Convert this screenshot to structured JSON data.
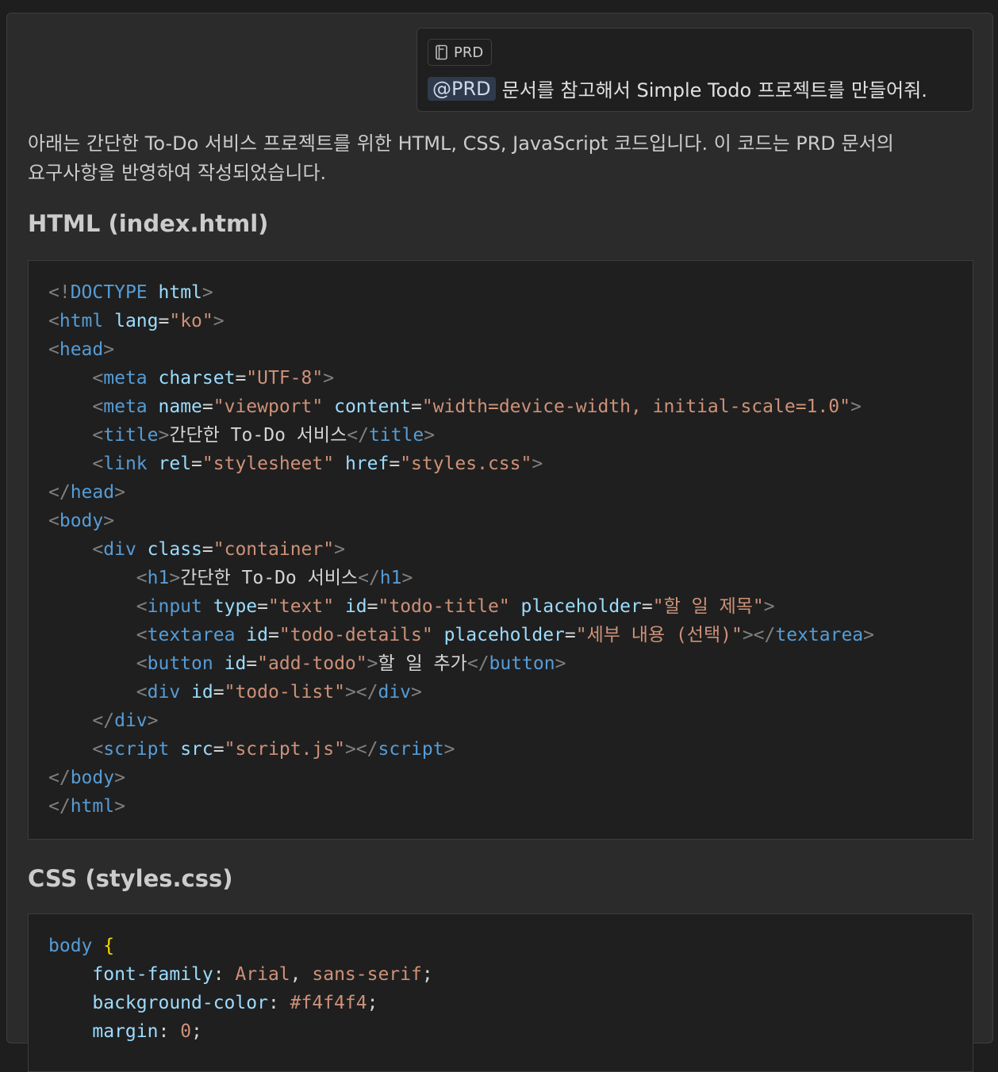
{
  "user_message": {
    "context_chip": {
      "icon": "document-icon",
      "label": "PRD"
    },
    "mention": "@PRD",
    "text": "문서를 참고해서 Simple Todo 프로젝트를 만들어줘."
  },
  "assistant": {
    "intro_line1": "아래는 간단한 To-Do 서비스 프로젝트를 위한 HTML, CSS, JavaScript 코드입니다. 이 코드는 PRD 문서의",
    "intro_line2": "요구사항을 반영하여 작성되었습니다.",
    "html_heading": "HTML (index.html)",
    "css_heading": "CSS (styles.css)",
    "html_code": [
      [
        [
          "br",
          "<!"
        ],
        [
          "tag",
          "DOCTYPE"
        ],
        [
          "txt",
          " "
        ],
        [
          "attr",
          "html"
        ],
        [
          "br",
          ">"
        ]
      ],
      [
        [
          "br",
          "<"
        ],
        [
          "tag",
          "html"
        ],
        [
          "txt",
          " "
        ],
        [
          "attr",
          "lang"
        ],
        [
          "txt",
          "="
        ],
        [
          "str",
          "\"ko\""
        ],
        [
          "br",
          ">"
        ]
      ],
      [
        [
          "br",
          "<"
        ],
        [
          "tag",
          "head"
        ],
        [
          "br",
          ">"
        ]
      ],
      [
        [
          "txt",
          "    "
        ],
        [
          "br",
          "<"
        ],
        [
          "tag",
          "meta"
        ],
        [
          "txt",
          " "
        ],
        [
          "attr",
          "charset"
        ],
        [
          "txt",
          "="
        ],
        [
          "str",
          "\"UTF-8\""
        ],
        [
          "br",
          ">"
        ]
      ],
      [
        [
          "txt",
          "    "
        ],
        [
          "br",
          "<"
        ],
        [
          "tag",
          "meta"
        ],
        [
          "txt",
          " "
        ],
        [
          "attr",
          "name"
        ],
        [
          "txt",
          "="
        ],
        [
          "str",
          "\"viewport\""
        ],
        [
          "txt",
          " "
        ],
        [
          "attr",
          "content"
        ],
        [
          "txt",
          "="
        ],
        [
          "str",
          "\"width=device-width, initial-scale=1.0\""
        ],
        [
          "br",
          ">"
        ]
      ],
      [
        [
          "txt",
          "    "
        ],
        [
          "br",
          "<"
        ],
        [
          "tag",
          "title"
        ],
        [
          "br",
          ">"
        ],
        [
          "txt",
          "간단한 To-Do 서비스"
        ],
        [
          "br",
          "</"
        ],
        [
          "tag",
          "title"
        ],
        [
          "br",
          ">"
        ]
      ],
      [
        [
          "txt",
          "    "
        ],
        [
          "br",
          "<"
        ],
        [
          "tag",
          "link"
        ],
        [
          "txt",
          " "
        ],
        [
          "attr",
          "rel"
        ],
        [
          "txt",
          "="
        ],
        [
          "str",
          "\"stylesheet\""
        ],
        [
          "txt",
          " "
        ],
        [
          "attr",
          "href"
        ],
        [
          "txt",
          "="
        ],
        [
          "str",
          "\"styles.css\""
        ],
        [
          "br",
          ">"
        ]
      ],
      [
        [
          "br",
          "</"
        ],
        [
          "tag",
          "head"
        ],
        [
          "br",
          ">"
        ]
      ],
      [
        [
          "br",
          "<"
        ],
        [
          "tag",
          "body"
        ],
        [
          "br",
          ">"
        ]
      ],
      [
        [
          "txt",
          "    "
        ],
        [
          "br",
          "<"
        ],
        [
          "tag",
          "div"
        ],
        [
          "txt",
          " "
        ],
        [
          "attr",
          "class"
        ],
        [
          "txt",
          "="
        ],
        [
          "str",
          "\"container\""
        ],
        [
          "br",
          ">"
        ]
      ],
      [
        [
          "txt",
          "        "
        ],
        [
          "br",
          "<"
        ],
        [
          "tag",
          "h1"
        ],
        [
          "br",
          ">"
        ],
        [
          "txt",
          "간단한 To-Do 서비스"
        ],
        [
          "br",
          "</"
        ],
        [
          "tag",
          "h1"
        ],
        [
          "br",
          ">"
        ]
      ],
      [
        [
          "txt",
          "        "
        ],
        [
          "br",
          "<"
        ],
        [
          "tag",
          "input"
        ],
        [
          "txt",
          " "
        ],
        [
          "attr",
          "type"
        ],
        [
          "txt",
          "="
        ],
        [
          "str",
          "\"text\""
        ],
        [
          "txt",
          " "
        ],
        [
          "attr",
          "id"
        ],
        [
          "txt",
          "="
        ],
        [
          "str",
          "\"todo-title\""
        ],
        [
          "txt",
          " "
        ],
        [
          "attr",
          "placeholder"
        ],
        [
          "txt",
          "="
        ],
        [
          "str",
          "\"할 일 제목\""
        ],
        [
          "br",
          ">"
        ]
      ],
      [
        [
          "txt",
          "        "
        ],
        [
          "br",
          "<"
        ],
        [
          "tag",
          "textarea"
        ],
        [
          "txt",
          " "
        ],
        [
          "attr",
          "id"
        ],
        [
          "txt",
          "="
        ],
        [
          "str",
          "\"todo-details\""
        ],
        [
          "txt",
          " "
        ],
        [
          "attr",
          "placeholder"
        ],
        [
          "txt",
          "="
        ],
        [
          "str",
          "\"세부 내용 (선택)\""
        ],
        [
          "br",
          "></"
        ],
        [
          "tag",
          "textarea"
        ],
        [
          "br",
          ">"
        ]
      ],
      [
        [
          "txt",
          "        "
        ],
        [
          "br",
          "<"
        ],
        [
          "tag",
          "button"
        ],
        [
          "txt",
          " "
        ],
        [
          "attr",
          "id"
        ],
        [
          "txt",
          "="
        ],
        [
          "str",
          "\"add-todo\""
        ],
        [
          "br",
          ">"
        ],
        [
          "txt",
          "할 일 추가"
        ],
        [
          "br",
          "</"
        ],
        [
          "tag",
          "button"
        ],
        [
          "br",
          ">"
        ]
      ],
      [
        [
          "txt",
          "        "
        ],
        [
          "br",
          "<"
        ],
        [
          "tag",
          "div"
        ],
        [
          "txt",
          " "
        ],
        [
          "attr",
          "id"
        ],
        [
          "txt",
          "="
        ],
        [
          "str",
          "\"todo-list\""
        ],
        [
          "br",
          "></"
        ],
        [
          "tag",
          "div"
        ],
        [
          "br",
          ">"
        ]
      ],
      [
        [
          "txt",
          "    "
        ],
        [
          "br",
          "</"
        ],
        [
          "tag",
          "div"
        ],
        [
          "br",
          ">"
        ]
      ],
      [
        [
          "txt",
          "    "
        ],
        [
          "br",
          "<"
        ],
        [
          "tag",
          "script"
        ],
        [
          "txt",
          " "
        ],
        [
          "attr",
          "src"
        ],
        [
          "txt",
          "="
        ],
        [
          "str",
          "\"script.js\""
        ],
        [
          "br",
          "></"
        ],
        [
          "tag",
          "script"
        ],
        [
          "br",
          ">"
        ]
      ],
      [
        [
          "br",
          "</"
        ],
        [
          "tag",
          "body"
        ],
        [
          "br",
          ">"
        ]
      ],
      [
        [
          "br",
          "</"
        ],
        [
          "tag",
          "html"
        ],
        [
          "br",
          ">"
        ]
      ]
    ],
    "css_code": [
      [
        [
          "tag",
          "body"
        ],
        [
          "txt",
          " "
        ],
        [
          "brace",
          "{"
        ]
      ],
      [
        [
          "txt",
          "    "
        ],
        [
          "attr",
          "font-family"
        ],
        [
          "punc",
          ": "
        ],
        [
          "str",
          "Arial"
        ],
        [
          "punc",
          ", "
        ],
        [
          "str",
          "sans-serif"
        ],
        [
          "punc",
          ";"
        ]
      ],
      [
        [
          "txt",
          "    "
        ],
        [
          "attr",
          "background-color"
        ],
        [
          "punc",
          ": "
        ],
        [
          "str",
          "#f4f4f4"
        ],
        [
          "punc",
          ";"
        ]
      ],
      [
        [
          "txt",
          "    "
        ],
        [
          "attr",
          "margin"
        ],
        [
          "punc",
          ": "
        ],
        [
          "str",
          "0"
        ],
        [
          "punc",
          ";"
        ]
      ]
    ]
  }
}
